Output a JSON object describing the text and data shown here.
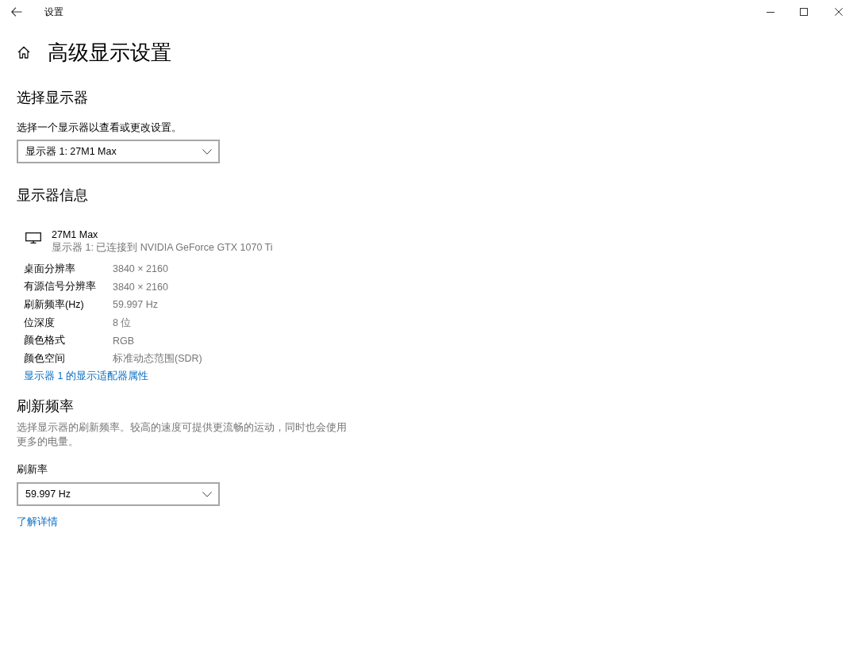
{
  "window": {
    "title": "设置"
  },
  "page": {
    "title": "高级显示设置"
  },
  "select_display": {
    "heading": "选择显示器",
    "description": "选择一个显示器以查看或更改设置。",
    "dropdown": {
      "value": "显示器 1: 27M1 Max"
    }
  },
  "display_info": {
    "heading": "显示器信息",
    "monitor": {
      "name": "27M1 Max",
      "subtitle": "显示器 1: 已连接到 NVIDIA GeForce GTX 1070 Ti"
    },
    "rows": [
      {
        "label": "桌面分辨率",
        "value": "3840 × 2160"
      },
      {
        "label": "有源信号分辨率",
        "value": "3840 × 2160"
      },
      {
        "label": "刷新频率(Hz)",
        "value": "59.997 Hz"
      },
      {
        "label": "位深度",
        "value": "8 位"
      },
      {
        "label": "颜色格式",
        "value": "RGB"
      },
      {
        "label": "颜色空间",
        "value": "标准动态范围(SDR)"
      }
    ],
    "link": "显示器 1 的显示适配器属性"
  },
  "refresh_rate": {
    "heading": "刷新频率",
    "description": "选择显示器的刷新频率。较高的速度可提供更流畅的运动，同时也会使用更多的电量。",
    "label": "刷新率",
    "dropdown": {
      "value": "59.997 Hz"
    },
    "link": "了解详情"
  }
}
